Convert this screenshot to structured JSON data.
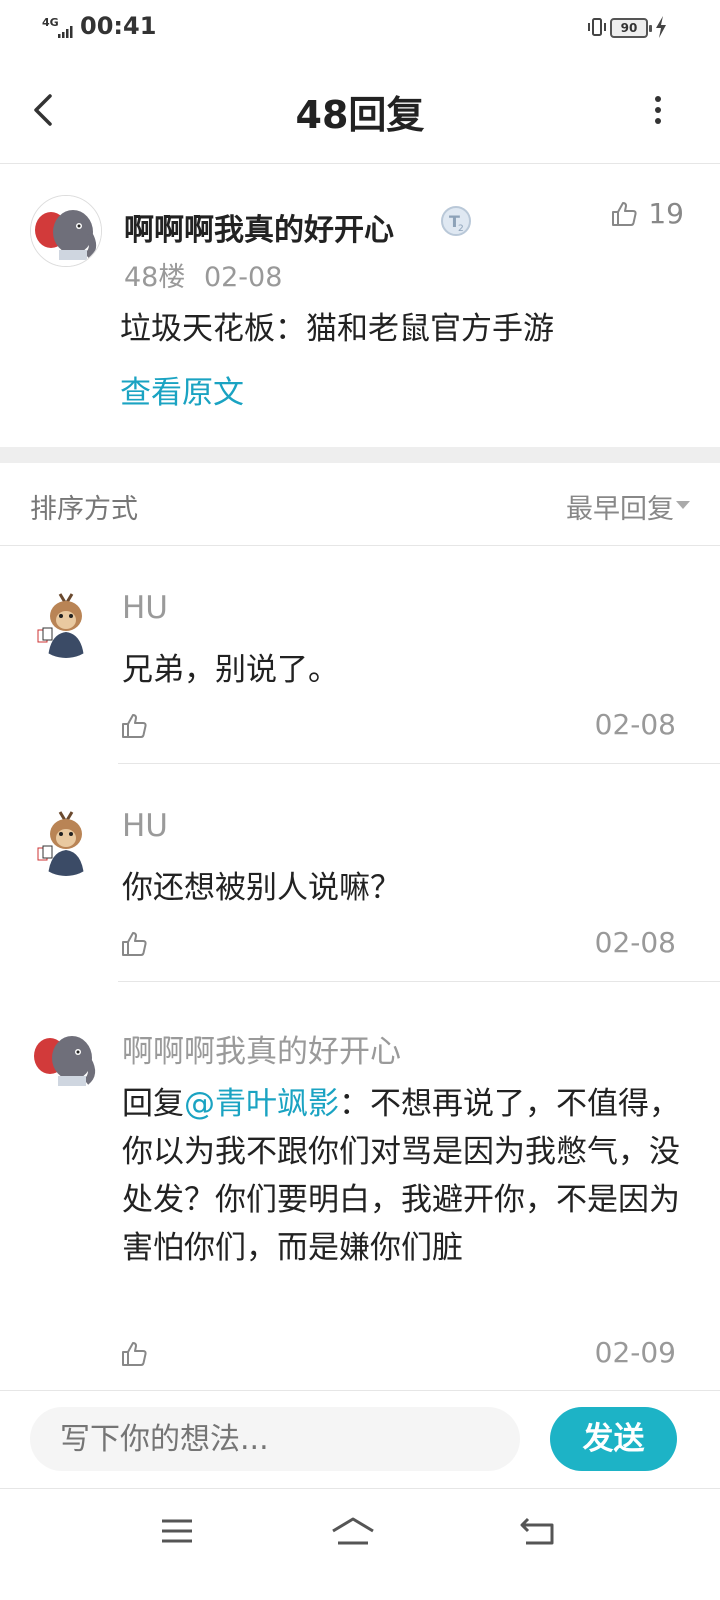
{
  "status_bar": {
    "network": "4G",
    "time": "00:41",
    "battery": "90"
  },
  "header": {
    "title": "48回复"
  },
  "post": {
    "author": "啊啊啊我真的好开心",
    "likes": "19",
    "floor": "48楼",
    "date": "02-08",
    "content": "垃圾天花板：猫和老鼠官方手游",
    "view_original": "查看原文"
  },
  "sort": {
    "label": "排序方式",
    "selected": "最早回复"
  },
  "replies": [
    {
      "author": "HU",
      "content": "兄弟，别说了。",
      "date": "02-08"
    },
    {
      "author": "HU",
      "content": "你还想被别人说嘛？",
      "date": "02-08"
    },
    {
      "author": "啊啊啊我真的好开心",
      "reply_prefix": "回复",
      "mention": "@青叶飒影",
      "content": "：不想再说了，不值得，你以为我不跟你们对骂是因为我憋气，没处发？你们要明白，我避开你，不是因为害怕你们，而是嫌你们脏",
      "date": "02-09"
    }
  ],
  "comment_box": {
    "placeholder": "写下你的想法...",
    "send_label": "发送"
  },
  "colors": {
    "accent": "#1aa3c2",
    "send_button": "#1db3c6"
  }
}
